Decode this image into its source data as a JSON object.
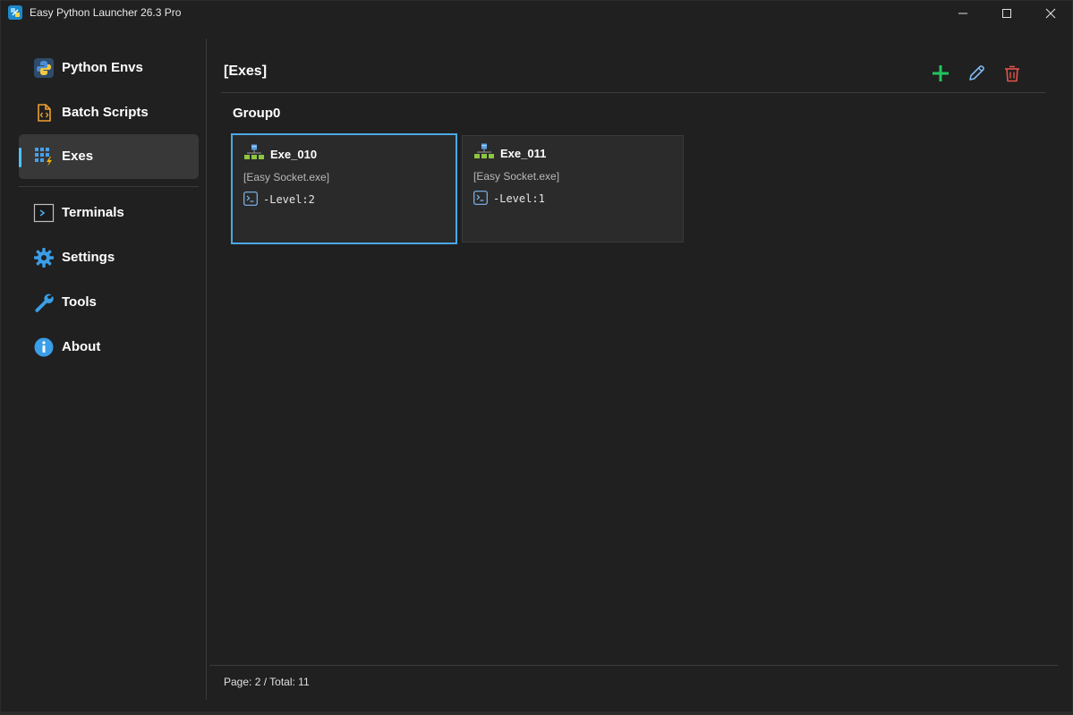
{
  "window": {
    "title": "Easy Python Launcher 26.3 Pro",
    "controls": {
      "minimize": "minimize-icon",
      "maximize": "maximize-icon",
      "close": "close-icon"
    }
  },
  "sidebar": {
    "items": [
      {
        "label": "Python Envs",
        "icon": "python-icon",
        "active": false
      },
      {
        "label": "Batch Scripts",
        "icon": "script-file-icon",
        "active": false
      },
      {
        "label": "Exes",
        "icon": "exe-grid-icon",
        "active": true
      },
      {
        "label": "Terminals",
        "icon": "terminal-icon",
        "active": false
      },
      {
        "label": "Settings",
        "icon": "gear-icon",
        "active": false
      },
      {
        "label": "Tools",
        "icon": "wrench-icon",
        "active": false
      },
      {
        "label": "About",
        "icon": "info-icon",
        "active": false
      }
    ]
  },
  "main": {
    "title": "[Exes]",
    "toolbar": {
      "add": "plus-icon",
      "edit": "pencil-icon",
      "delete": "trash-icon"
    },
    "group": {
      "title": "Group0",
      "cards": [
        {
          "name": "Exe_010",
          "subtitle": "[Easy Socket.exe]",
          "args": "-Level:2",
          "selected": true
        },
        {
          "name": "Exe_011",
          "subtitle": "[Easy Socket.exe]",
          "args": "-Level:1",
          "selected": false
        }
      ]
    },
    "footer": {
      "pagination": "Page: 2 / Total: 11"
    }
  },
  "colors": {
    "accent": "#4cc2ff",
    "add": "#22c55e",
    "edit": "#7fb8ef",
    "delete": "#e5534b",
    "background": "#202020"
  }
}
